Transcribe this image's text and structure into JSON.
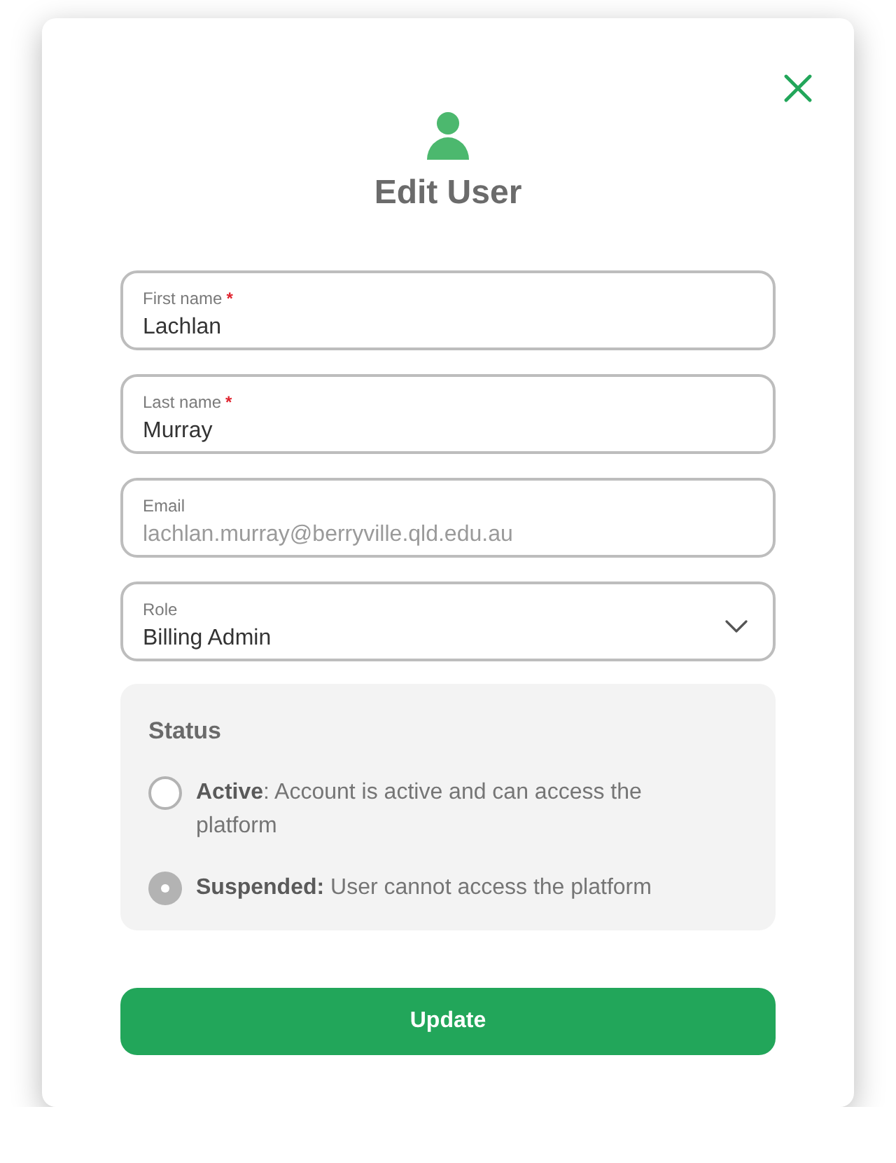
{
  "dialog": {
    "title": "Edit User"
  },
  "fields": [
    {
      "kind": "text",
      "label": "First name",
      "required_mark": "*",
      "value": "Lachlan",
      "disabled": false
    },
    {
      "kind": "text",
      "label": "Last name",
      "required_mark": "*",
      "value": "Murray",
      "disabled": false
    },
    {
      "kind": "text",
      "label": "Email",
      "value": "lachlan.murray@berryville.qld.edu.au",
      "disabled": true
    },
    {
      "kind": "select",
      "label": "Role",
      "value": "Billing Admin",
      "disabled": false
    }
  ],
  "status": {
    "heading": "Status",
    "options": [
      {
        "text": "**Active**: Account is active and can access the platform",
        "selected": false
      },
      {
        "text": "**Suspended:** User cannot access the platform",
        "selected": true
      }
    ]
  },
  "buttons": [
    "Update"
  ]
}
